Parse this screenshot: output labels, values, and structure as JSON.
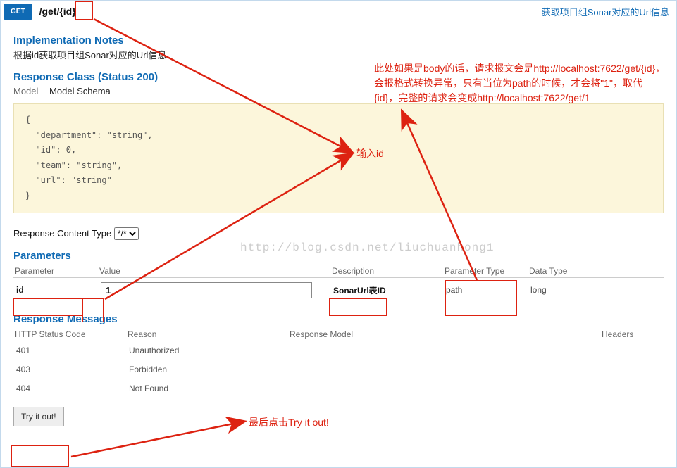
{
  "header": {
    "method": "GET",
    "path": "/get/{id}",
    "summary": "获取项目组Sonar对应的Url信息"
  },
  "impl_notes": {
    "heading": "Implementation Notes",
    "text": "根据id获取项目组Sonar对应的Url信息"
  },
  "response_class": {
    "heading": "Response Class (Status 200)",
    "tab_model": "Model",
    "tab_schema": "Model Schema",
    "schema": "{\n  \"department\": \"string\",\n  \"id\": 0,\n  \"team\": \"string\",\n  \"url\": \"string\"\n}"
  },
  "rct": {
    "label": "Response Content Type",
    "value": "*/*"
  },
  "parameters": {
    "heading": "Parameters",
    "cols": {
      "parameter": "Parameter",
      "value": "Value",
      "description": "Description",
      "ptype": "Parameter Type",
      "dtype": "Data Type"
    },
    "row": {
      "name": "id",
      "value": "1",
      "description": "SonarUrl表ID",
      "ptype": "path",
      "dtype": "long"
    }
  },
  "responses": {
    "heading": "Response Messages",
    "cols": {
      "code": "HTTP Status Code",
      "reason": "Reason",
      "model": "Response Model",
      "headers": "Headers"
    },
    "rows": [
      {
        "code": "401",
        "reason": "Unauthorized"
      },
      {
        "code": "403",
        "reason": "Forbidden"
      },
      {
        "code": "404",
        "reason": "Not Found"
      }
    ]
  },
  "try_button": "Try it out!",
  "annotations": {
    "input_id": "输入id",
    "body_note": "此处如果是body的话，请求报文会是http://localhost:7622/get/{id}，会报格式转换异常，只有当位为path的时候，才会将\"1\"，取代{id}，完整的请求会变成http://localhost:7622/get/1",
    "click_try": "最后点击Try it out!"
  },
  "watermark": "http://blog.csdn.net/liuchuanhong1"
}
